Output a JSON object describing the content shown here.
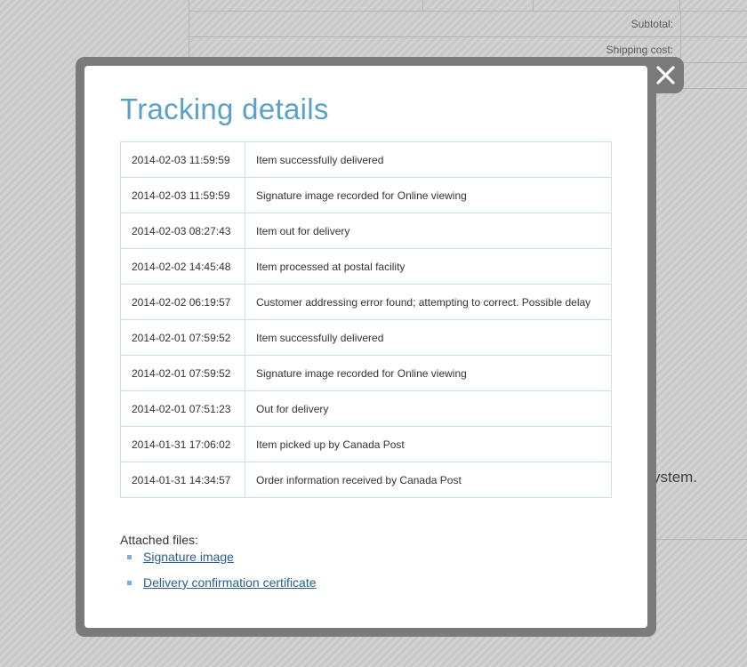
{
  "background": {
    "summary_rows": [
      {
        "label": "Subtotal:",
        "value": ""
      },
      {
        "label": "Shipping cost:",
        "value": ""
      },
      {
        "label": "",
        "value": ""
      }
    ],
    "partial_text": "ystem."
  },
  "modal": {
    "title": "Tracking details",
    "close_icon": "close-icon",
    "rows": [
      {
        "date": "2014-02-03 11:59:59",
        "event": "Item successfully delivered"
      },
      {
        "date": "2014-02-03 11:59:59",
        "event": "Signature image recorded for Online viewing"
      },
      {
        "date": "2014-02-03 08:27:43",
        "event": "Item out for delivery"
      },
      {
        "date": "2014-02-02 14:45:48",
        "event": "Item processed at postal facility"
      },
      {
        "date": "2014-02-02 06:19:57",
        "event": "Customer addressing error found; attempting to correct. Possible delay"
      },
      {
        "date": "2014-02-01 07:59:52",
        "event": "Item successfully delivered"
      },
      {
        "date": "2014-02-01 07:59:52",
        "event": "Signature image recorded for Online viewing"
      },
      {
        "date": "2014-02-01 07:51:23",
        "event": "Out for delivery"
      },
      {
        "date": "2014-01-31 17:06:02",
        "event": "Item picked up by Canada Post"
      },
      {
        "date": "2014-01-31 14:34:57",
        "event": "Order information received by Canada Post"
      }
    ],
    "attached_label": "Attached files:",
    "files": [
      {
        "label": "Signature image"
      },
      {
        "label": "Delivery confirmation certificate"
      }
    ]
  },
  "colors": {
    "title": "#5aa0c8",
    "link": "#2a5e8c",
    "bullet": "#79aee0",
    "overlay_frame": "#7a7a7a"
  }
}
